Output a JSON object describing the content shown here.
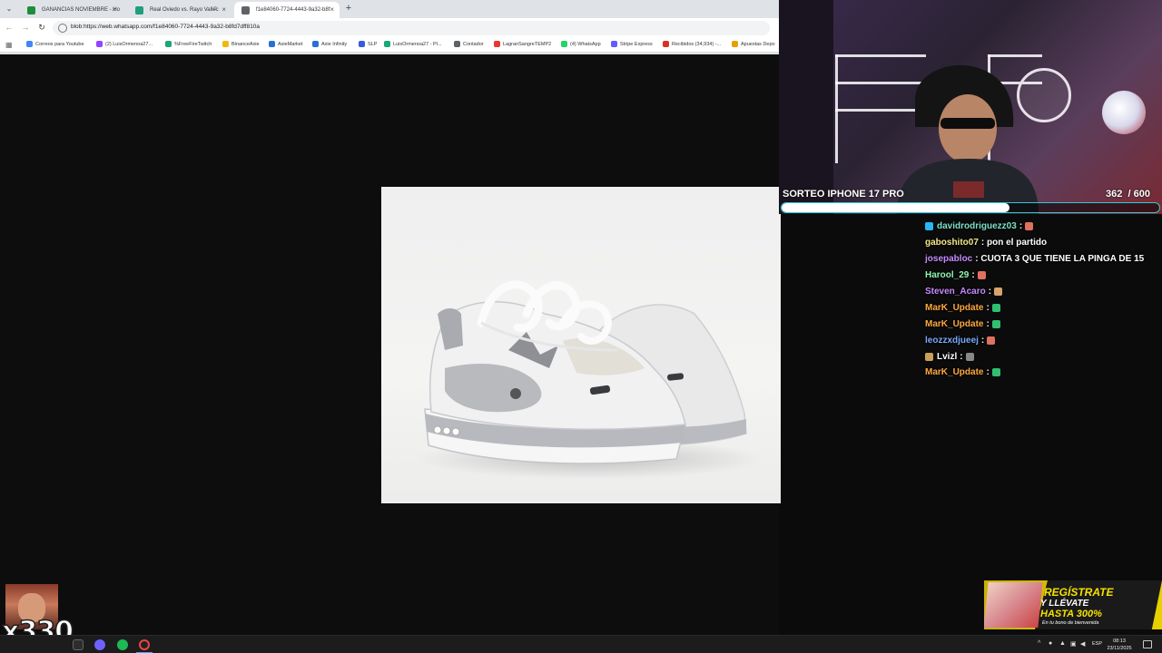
{
  "browser": {
    "tabs": [
      {
        "title": "GANANCIAS NOVIEMBRE - Ho",
        "favicon_color": "#1e8e3e",
        "active": false
      },
      {
        "title": "Real Oviedo vs. Rayo Vallec",
        "favicon_color": "#1f9f7c",
        "active": false,
        "audio": true
      },
      {
        "title": "f1e84060-7724-4443-9a32-b8f",
        "favicon_color": "#5f6368",
        "active": true
      }
    ],
    "url": "blob:https://web.whatsapp.com/f1e84060-7724-4443-9a32-b8fd7dff810a",
    "bookmarks": [
      {
        "label": "Correos para Youtube",
        "icon_color": "#4285f4"
      },
      {
        "label": "(2) LuisOrmenoa27...",
        "icon_color": "#9146ff"
      },
      {
        "label": "%FreeFireTwitch",
        "icon_color": "#1aa87a"
      },
      {
        "label": "BinanceAxie",
        "icon_color": "#f0b90b"
      },
      {
        "label": "AxieMarket",
        "icon_color": "#2b6fd6"
      },
      {
        "label": "Axie Infinity",
        "icon_color": "#2b6fd6"
      },
      {
        "label": "SLP",
        "icon_color": "#3a5bd9"
      },
      {
        "label": "LuisOrmenoa27 - Pl...",
        "icon_color": "#1aa87a"
      },
      {
        "label": "Contador",
        "icon_color": "#5f6368"
      },
      {
        "label": "LagranSangreTEMP2",
        "icon_color": "#e53935"
      },
      {
        "label": "(4) WhatsApp",
        "icon_color": "#25d366"
      },
      {
        "label": "Stripe Express",
        "icon_color": "#635bff"
      },
      {
        "label": "Recibidos (34,934) -...",
        "icon_color": "#d93025"
      },
      {
        "label": "Apuestas Depo",
        "icon_color": "#e8a000"
      }
    ]
  },
  "giveaway": {
    "title": "SORTEO IPHONE 17 PRO",
    "current": "362",
    "total": "/ 600",
    "progress": 0.603
  },
  "chat": [
    {
      "user": "davidrodriguezz03",
      "text": ":",
      "color": "#7fe0c8",
      "badge_color": "#29b6f6",
      "emote_color": "#e07060"
    },
    {
      "user": "gaboshito07",
      "text": ": pon el partido",
      "color": "#f4e98a",
      "badge_color": "",
      "emote_color": ""
    },
    {
      "user": "josepabloc",
      "text": ": CUOTA 3 QUE TIENE LA PINGA DE 15",
      "color": "#c68cff",
      "badge_color": "",
      "emote_color": ""
    },
    {
      "user": "Harool_29",
      "text": ":",
      "color": "#8ff5b0",
      "badge_color": "",
      "emote_color": "#e07060"
    },
    {
      "user": "Steven_Acaro",
      "text": ":",
      "color": "#c68cff",
      "badge_color": "",
      "emote_color": "#d9a36b"
    },
    {
      "user": "MarK_Update",
      "text": ":",
      "color": "#ffa940",
      "badge_color": "",
      "emote_color": "#2fbf71"
    },
    {
      "user": "MarK_Update",
      "text": ":",
      "color": "#ffa940",
      "badge_color": "",
      "emote_color": "#2fbf71"
    },
    {
      "user": "leozzxdjueej",
      "text": ":",
      "color": "#7aa9ff",
      "badge_color": "",
      "emote_color": "#e07060"
    },
    {
      "user": "Lvizl",
      "text": ":",
      "color": "#ffffff",
      "badge_color": "#c9a15a",
      "emote_color": "#888888"
    },
    {
      "user": "MarK_Update",
      "text": ":",
      "color": "#ffa940",
      "badge_color": "",
      "emote_color": "#2fbf71"
    }
  ],
  "overlay": {
    "multiplier": "x330"
  },
  "ad": {
    "line1": "REGÍSTRATE",
    "line2": "Y LLÉVATE",
    "line3": "HASTA 300%",
    "line4": "En tu bono de bienvenida"
  },
  "taskbar": {
    "lang": "ESP",
    "time": "08:13",
    "date": "23/11/2025"
  }
}
